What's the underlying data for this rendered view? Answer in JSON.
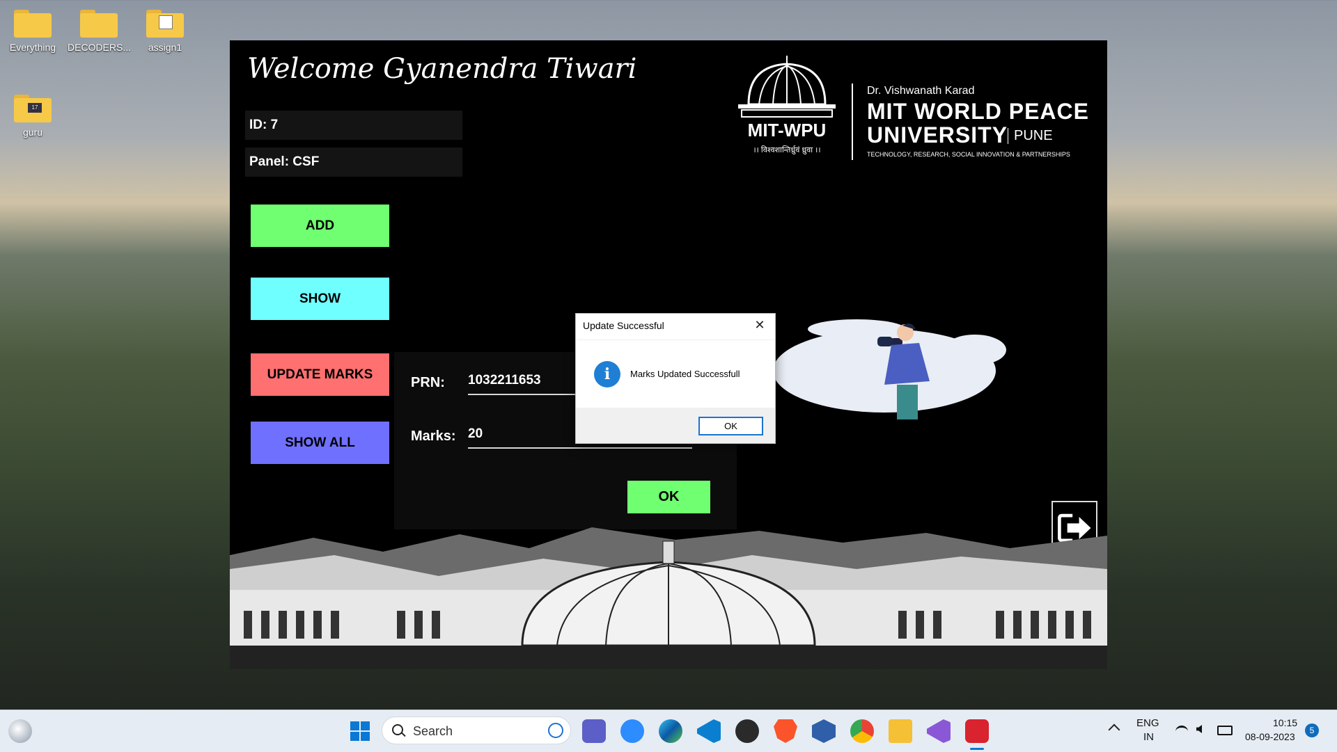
{
  "desktop": {
    "icons": [
      {
        "label": "Everything"
      },
      {
        "label": "DECODERS..."
      },
      {
        "label": "assign1"
      },
      {
        "label": "guru"
      }
    ]
  },
  "app": {
    "welcome": "Welcome Gyanendra Tiwari",
    "id_text": "ID: 7",
    "panel_text": "Panel: CSF",
    "buttons": {
      "add": "ADD",
      "show": "SHOW",
      "update_marks": "UPDATE MARKS",
      "show_all": "SHOW ALL"
    },
    "button_colors": {
      "add": "#70ff70",
      "show": "#70ffff",
      "update_marks": "#ff7070",
      "show_all": "#7070ff"
    },
    "logo": {
      "short_name": "MIT-WPU",
      "tagline": "।। विश्वशान्तिर्ध्रुवं ध्रुवा ।।",
      "line1": "Dr. Vishwanath Karad",
      "line2": "MIT WORLD PEACE",
      "line3": "UNIVERSITY",
      "city": "PUNE",
      "line4": "TECHNOLOGY, RESEARCH, SOCIAL INNOVATION & PARTNERSHIPS"
    },
    "form": {
      "prn_label": "PRN:",
      "prn_value": "1032211653",
      "marks_label": "Marks:",
      "marks_value": "20",
      "ok_label": "OK"
    },
    "exit_icon": "exit-arrow-icon"
  },
  "dialog": {
    "title": "Update Successful",
    "close_label": "✕",
    "icon": "info-icon",
    "icon_glyph": "i",
    "message": "Marks Updated Successfull",
    "ok_label": "OK"
  },
  "taskbar": {
    "search_label": "Search",
    "language": "ENG",
    "region": "IN",
    "time": "10:15",
    "date": "08-09-2023",
    "notification_count": "5"
  }
}
